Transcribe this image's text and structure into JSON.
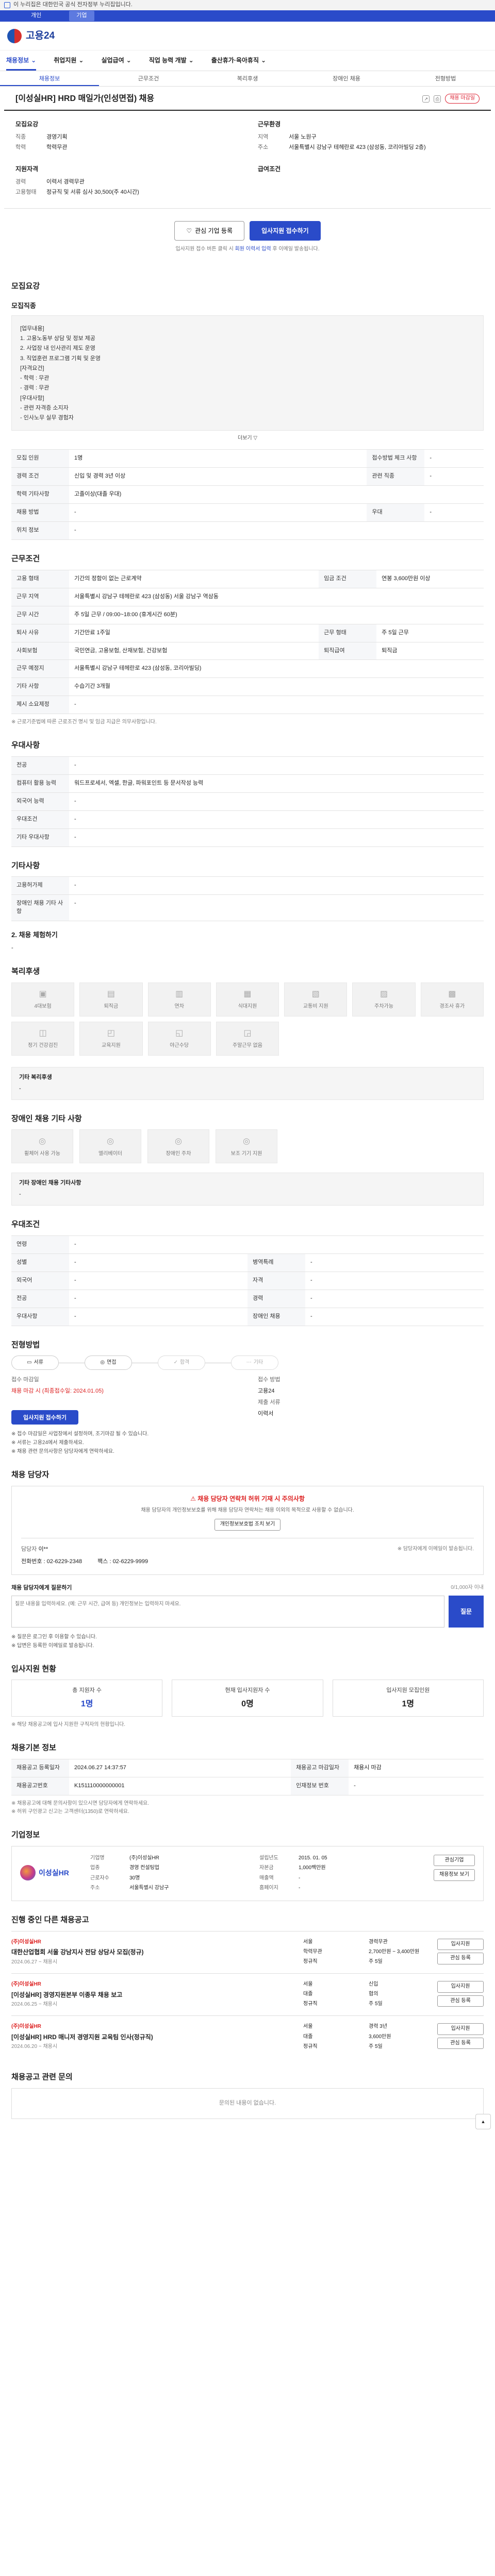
{
  "topline": {
    "text": "이 누리집은 대한민국 공식 전자정부 누리집입니다."
  },
  "bluebar": {
    "tabs": [
      "개인",
      "기업"
    ]
  },
  "logo": {
    "text": "고용24"
  },
  "nav": [
    "채용정보",
    "취업지원",
    "실업급여",
    "직업 능력 개발",
    "출산휴가·육아휴직"
  ],
  "subtabs": [
    "채용정보",
    "근무조건",
    "복리후생",
    "장애인 채용",
    "전형방법"
  ],
  "job": {
    "title": "[이성실HR] HRD 매일가(인성면접) 채용",
    "badge": "채용 마감일"
  },
  "recruit": {
    "head": "모집요강",
    "rows": [
      [
        "직종",
        "경영기획"
      ],
      [
        "학력",
        "학력무관"
      ]
    ]
  },
  "company": {
    "head": "근무환경",
    "rows": [
      [
        "지역",
        "서울 노원구"
      ],
      [
        "주소",
        "서울특별시 강남구 테헤란로 423 (삼성동, 코리아빌딩 2층)"
      ]
    ]
  },
  "qual": {
    "head": "지원자격",
    "rows": [
      [
        "경력",
        "이력서 경력무관"
      ],
      [
        "고용형태",
        "정규직 및 서류 심사 30,500(주 40시간)"
      ]
    ]
  },
  "pay": {
    "head": "급여조건",
    "rows": []
  },
  "buttons": {
    "interest": "관심 기업 등록",
    "apply": "입사지원 접수하기"
  },
  "apply_note": {
    "pre": "입사지원 접수 버튼 클릭 시 ",
    "hl": "회원 이력서 입력",
    "post": " 후 이메일 발송됩니다."
  },
  "s1": {
    "title": "모집요강",
    "subtitle": "모집직종",
    "job_lines": [
      "[업무내용]",
      "1. 고용노동부 상담 및 정보 제공",
      "2. 사업장 내 인사관리 제도 운영",
      "3. 직업훈련 프로그램 기획 및 운영",
      "",
      "[자격요건]",
      "- 학력 : 무관",
      "- 경력 : 무관",
      "",
      "[우대사항]",
      "- 관련 자격증 소지자",
      "- 인사노무 실무 경험자"
    ],
    "more": "더보기 ▽",
    "rows": [
      [
        "모집 인원",
        "1명",
        "접수방법 체크 사항",
        "-"
      ],
      [
        "경력 조건",
        "신입 및 경력 3년 이상",
        "관련 직종",
        "-"
      ],
      [
        "학력 기타사항",
        "고졸이상(대졸 우대)",
        "",
        ""
      ],
      [
        "채용 방법",
        "-",
        "우대",
        "-"
      ],
      [
        "위치 정보",
        "-",
        "",
        ""
      ]
    ]
  },
  "s2": {
    "title": "근무조건",
    "rows": [
      [
        "고용 형태",
        "기간의 정함이 없는 근로계약",
        "임금 조건",
        "연봉 3,600만원 이상"
      ],
      [
        "근무 지역",
        "서울특별시 강남구 테헤란로 423 (삼성동) 서울 강남구 역삼동"
      ],
      [
        "근무 시간",
        "주 5일 근무 / 09:00~18:00 (휴게시간 60분)"
      ],
      [
        "퇴사 사유",
        "기간만료 1주일",
        "근무 형태",
        "주 5일 근무"
      ],
      [
        "사회보험",
        "국민연금, 고용보험, 산재보험, 건강보험",
        "퇴직급여",
        "퇴직금"
      ],
      [
        "근무 예정지",
        "서울특별시 강남구 테헤란로 423 (삼성동, 코리아빌딩)",
        "",
        ""
      ],
      [
        "기타 사항",
        "수습기간 3개월",
        "",
        ""
      ],
      [
        "제시 소요제정",
        "-",
        "",
        ""
      ]
    ],
    "note": "※ 근로기준법에 따른 근로조건 명시 및 임금 지급은 의무사항입니다."
  },
  "s3": {
    "title": "우대사항",
    "rows": [
      [
        "전공",
        "-"
      ],
      [
        "컴퓨터 활용 능력",
        "워드프로세서, 엑셀, 한글, 파워포인트 등 문서작성 능력"
      ],
      [
        "외국어 능력",
        "-"
      ],
      [
        "우대조건",
        "-"
      ],
      [
        "기타 우대사항",
        "-"
      ]
    ]
  },
  "s4": {
    "title": "기타사항",
    "rows": [
      [
        "고용허가제",
        "-"
      ],
      [
        "장애인 채용 기타 사항",
        "-"
      ]
    ],
    "note_head": "2. 채용 체험하기",
    "note_body": "-"
  },
  "s5": {
    "title": "복리후생",
    "tiles": [
      "4대보험",
      "퇴직금",
      "연차",
      "식대지원",
      "교통비 지원",
      "주차가능",
      "경조사 휴가",
      "정기 건강검진",
      "교육지원",
      "야근수당",
      "주말근무 없음"
    ],
    "etc_head": "기타 복리후생",
    "etc_body": "-"
  },
  "s6": {
    "title": "장애인 채용 기타 사항",
    "tiles": [
      "휠체어 사용 가능",
      "엘리베이터",
      "장애인 주차",
      "보조 기기 지원"
    ],
    "etc_head": "기타 장애인 채용 기타사항",
    "etc_body": "-"
  },
  "s7": {
    "title": "우대조건",
    "rows": [
      [
        "연령",
        "-"
      ],
      [
        "성별",
        "-",
        "병역특례",
        "-"
      ],
      [
        "외국어",
        "-",
        "자격",
        "-"
      ],
      [
        "전공",
        "-",
        "경력",
        "-"
      ],
      [
        "우대사항",
        "-",
        "장애인 채용",
        "-"
      ]
    ]
  },
  "s8": {
    "title": "전형방법",
    "steps": [
      "서류",
      "면접",
      "합격",
      "기타"
    ],
    "info": [
      [
        "접수 마감일",
        "접수 방법"
      ],
      [
        "채용 마감 시 (최종접수일: 2024.01.05)",
        "고용24"
      ],
      [
        "",
        "제출 서류"
      ],
      [
        "입사지원 접수하기",
        "이력서"
      ]
    ],
    "bullets": [
      "※ 접수 마감일은 사업장에서 설정하며, 조기마감 될 수 있습니다.",
      "※ 서류는 고용24에서 제출하세요.",
      "※ 채용 관련 문의사항은 담당자에게 연락하세요."
    ]
  },
  "s9": {
    "title": "채용 담당자",
    "warn_title": "채용 담당자 연락처 허위 기재 시 주의사항",
    "warn_body": "채용 담당자의 개인정보보호를 위해 채용 담당자 연락처는 채용 이외의 목적으로 사용할 수 없습니다.",
    "warn_btn": "개인정보보호법 조치 보기",
    "name_label": "담당자",
    "name": "이**",
    "mail_note": "※ 담당자에게 이메일이 발송됩니다.",
    "phone": "전화번호 : 02-6229-2348",
    "fax": "팩스 : 02-6229-9999",
    "qa_label": "채용 담당자에게 질문하기",
    "qa_hint": "0/1,000자 이내",
    "qa_placeholder": "질문 내용을 입력하세요. (예: 근무 시간, 급여 등) 개인정보는 입력하지 마세요.",
    "qa_btn": "질문",
    "qa_notes": [
      "※ 질문은 로그인 후 이용할 수 있습니다.",
      "※ 답변은 등록한 이메일로 발송됩니다."
    ]
  },
  "s10": {
    "title": "입사지원 현황",
    "labels": [
      "총 지원자 수",
      "현재 입사지원자 수",
      "입사지원 모집인원"
    ],
    "values": [
      "1명",
      "0명",
      "1명"
    ],
    "note": "※ 해당 채용공고에 입사 지원한 구직자의 현황입니다."
  },
  "s11": {
    "title": "채용기본 정보",
    "rows": [
      [
        "채용공고 등록일자",
        "2024.06.27 14:37:57",
        "채용공고 마감일자",
        "채용시 마감"
      ],
      [
        "채용공고번호",
        "K151110000000001",
        "인재정보 번호",
        "-"
      ]
    ],
    "notes": [
      "※ 채용공고에 대해 문의사항이 있으시면 담당자에게 연락하세요.",
      "※ 허위 구인광고 신고는 고객센터(1350)로 연락하세요."
    ]
  },
  "s12": {
    "title": "기업정보",
    "logo": "이성실HR",
    "rows": [
      [
        "기업명",
        "(주)이성실HR",
        "설립년도",
        "2015. 01. 05"
      ],
      [
        "업종",
        "경영 컨설팅업",
        "자본금",
        "1,000백만원"
      ],
      [
        "근로자수",
        "30명",
        "매출액",
        "-"
      ],
      [
        "주소",
        "서울특별시 강남구",
        "홈페이지",
        "-"
      ]
    ],
    "btns": [
      "관심기업",
      "채용정보 보기"
    ]
  },
  "s13": {
    "title": "진행 중인 다른 채용공고",
    "jobs": [
      {
        "comp": "(주)이성실HR",
        "title": "대한산업협회 서울 강남지사 전담 상담사 모집(정규)",
        "date": "2024.06.27 ~ 채용시",
        "meta": [
          "서울",
          "경력무관",
          "학력무관",
          "2,700만원 ~ 3,400만원",
          "정규직",
          "주 5일"
        ]
      },
      {
        "comp": "(주)이성실HR",
        "title": "[이성실HR] 경영지원본부 이종무 채용 보고",
        "date": "2024.06.25 ~ 채용시",
        "meta": [
          "서울",
          "신입",
          "대졸",
          "협의",
          "정규직",
          "주 5일"
        ]
      },
      {
        "comp": "(주)이성실HR",
        "title": "[이성실HR] HRD 매니저 경영지원 교육팀 인사(정규직)",
        "date": "2024.06.20 ~ 채용시",
        "meta": [
          "서울",
          "경력 3년",
          "대졸",
          "3,600만원",
          "정규직",
          "주 5일"
        ]
      }
    ],
    "act_btns": [
      "입사지원",
      "관심 등록"
    ]
  },
  "s14": {
    "title": "채용공고 관련 문의",
    "empty": "문의된 내용이 없습니다."
  }
}
